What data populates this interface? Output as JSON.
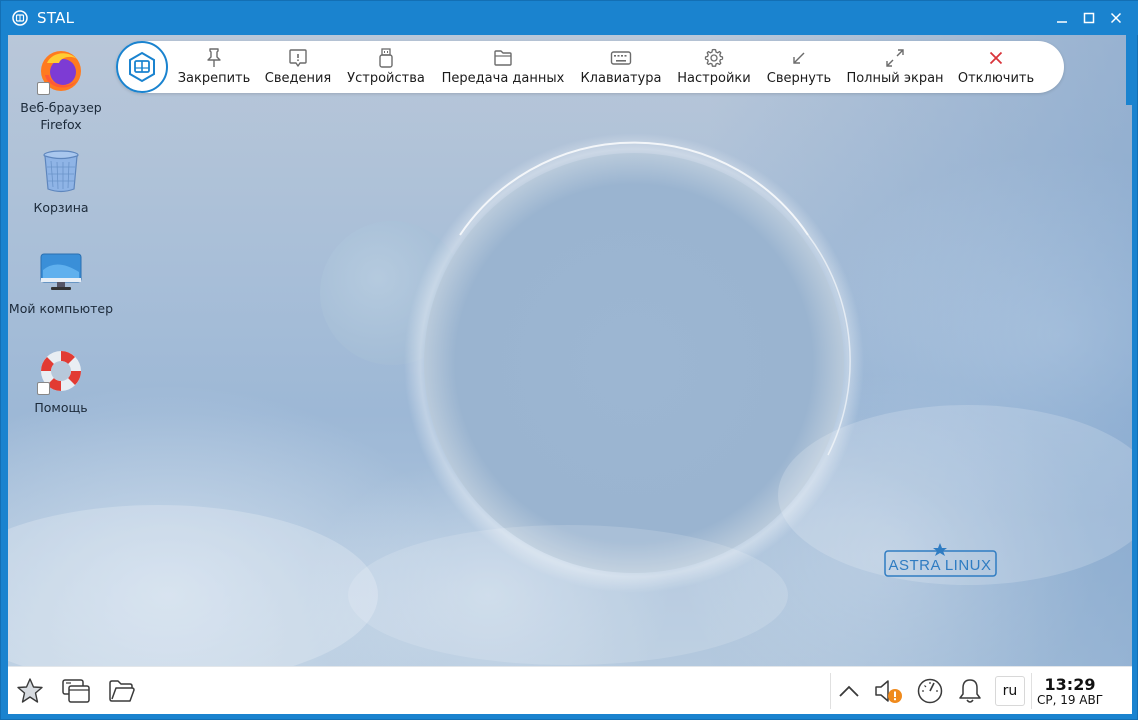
{
  "window": {
    "title": "STAL",
    "accent": "#1a83cf"
  },
  "desktop_icons": [
    {
      "label": "Веб-браузер Firefox",
      "icon": "firefox-icon"
    },
    {
      "label": "Корзина",
      "icon": "trash-icon"
    },
    {
      "label": "Мой компьютер",
      "icon": "computer-icon"
    },
    {
      "label": "Помощь",
      "icon": "lifebuoy-icon"
    }
  ],
  "remote_toolbar": {
    "items": [
      {
        "label": "Закрепить",
        "icon": "pin-icon"
      },
      {
        "label": "Сведения",
        "icon": "info-icon"
      },
      {
        "label": "Устройства",
        "icon": "usb-icon"
      },
      {
        "label": "Передача данных",
        "icon": "folder-icon"
      },
      {
        "label": "Клавиатура",
        "icon": "keyboard-icon"
      },
      {
        "label": "Настройки",
        "icon": "gear-icon"
      },
      {
        "label": "Свернуть",
        "icon": "minimize-arrow-icon"
      },
      {
        "label": "Полный экран",
        "icon": "fullscreen-icon"
      },
      {
        "label": "Отключить",
        "icon": "close-icon"
      }
    ],
    "disconnect_color": "#d9343a"
  },
  "wallpaper": {
    "logo_text": "ASTRA LINUX"
  },
  "taskbar": {
    "language": "ru",
    "time": "13:29",
    "date": "СР, 19 АВГ"
  }
}
